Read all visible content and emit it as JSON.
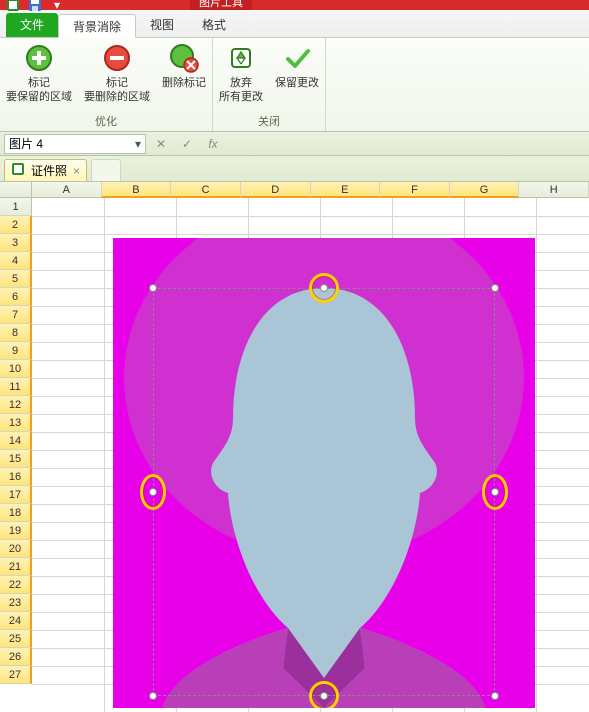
{
  "context_tab": "图片工具",
  "tabs": {
    "file": "文件",
    "bgremove": "背景消除",
    "view": "视图",
    "format": "格式"
  },
  "ribbon": {
    "group1": {
      "title": "优化",
      "btn_keep": "标记\n要保留的区域",
      "btn_remove": "标记\n要删除的区域",
      "btn_delmark": "删除标记"
    },
    "group2": {
      "title": "关闭",
      "btn_discard": "放弃\n所有更改",
      "btn_keepchg": "保留更改"
    }
  },
  "namebox": "图片 4",
  "fx": "fx",
  "workbook_tab": "证件照",
  "columns": [
    "A",
    "B",
    "C",
    "D",
    "E",
    "F",
    "G",
    "H"
  ],
  "rows": [
    "1",
    "2",
    "3",
    "4",
    "5",
    "6",
    "7",
    "8",
    "9",
    "10",
    "11",
    "12",
    "13",
    "14",
    "15",
    "16",
    "17",
    "18",
    "19",
    "20",
    "21",
    "22",
    "23",
    "24",
    "25",
    "26",
    "27"
  ],
  "chart_data": null
}
